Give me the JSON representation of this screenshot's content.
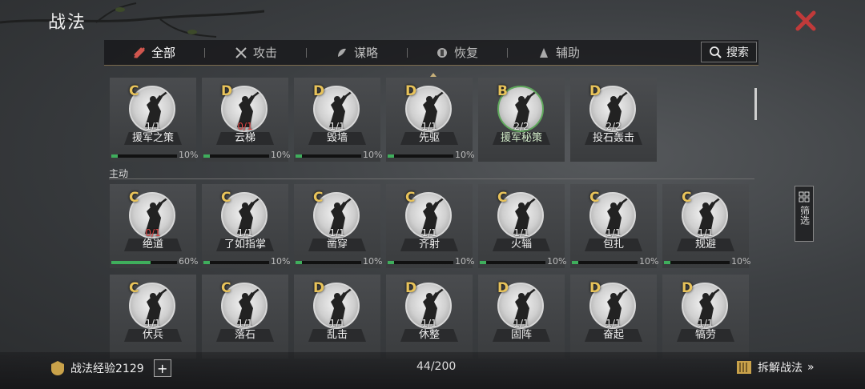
{
  "header": {
    "title": "战法"
  },
  "tabs": [
    {
      "label": "全部",
      "icon": "all-icon",
      "active": true
    },
    {
      "label": "攻击",
      "icon": "crossed-swords-icon",
      "active": false
    },
    {
      "label": "谋略",
      "icon": "strategy-icon",
      "active": false
    },
    {
      "label": "恢复",
      "icon": "recover-icon",
      "active": false
    },
    {
      "label": "辅助",
      "icon": "support-icon",
      "active": false
    }
  ],
  "search": {
    "label": "搜索"
  },
  "filter": {
    "label": "筛选"
  },
  "sections": {
    "active_label": "主动"
  },
  "cards": [
    {
      "grade": "C",
      "count": "1/1",
      "name": "援军之策",
      "progress": 10,
      "pct_text": "10%",
      "count_red": false,
      "green": false
    },
    {
      "grade": "D",
      "count": "0/1",
      "name": "云梯",
      "progress": 10,
      "pct_text": "10%",
      "count_red": true,
      "green": false
    },
    {
      "grade": "D",
      "count": "1/1",
      "name": "毁墙",
      "progress": 10,
      "pct_text": "10%",
      "count_red": false,
      "green": false
    },
    {
      "grade": "D",
      "count": "1/1",
      "name": "先驱",
      "progress": 10,
      "pct_text": "10%",
      "count_red": false,
      "green": false
    },
    {
      "grade": "B",
      "count": "2/2",
      "name": "援军秘策",
      "progress": null,
      "pct_text": "",
      "count_red": false,
      "green": true
    },
    {
      "grade": "D",
      "count": "2/2",
      "name": "投石轰击",
      "progress": null,
      "pct_text": "",
      "count_red": false,
      "green": false
    },
    {
      "grade": "C",
      "count": "0/1",
      "name": "绝道",
      "progress": 60,
      "pct_text": "60%",
      "count_red": true,
      "green": false
    },
    {
      "grade": "C",
      "count": "1/1",
      "name": "了如指掌",
      "progress": 10,
      "pct_text": "10%",
      "count_red": false,
      "green": false
    },
    {
      "grade": "C",
      "count": "1/1",
      "name": "凿穿",
      "progress": 10,
      "pct_text": "10%",
      "count_red": false,
      "green": false
    },
    {
      "grade": "C",
      "count": "1/1",
      "name": "齐射",
      "progress": 10,
      "pct_text": "10%",
      "count_red": false,
      "green": false
    },
    {
      "grade": "C",
      "count": "1/1",
      "name": "火辎",
      "progress": 10,
      "pct_text": "10%",
      "count_red": false,
      "green": false
    },
    {
      "grade": "C",
      "count": "1/1",
      "name": "包扎",
      "progress": 10,
      "pct_text": "10%",
      "count_red": false,
      "green": false
    },
    {
      "grade": "C",
      "count": "1/1",
      "name": "规避",
      "progress": 10,
      "pct_text": "10%",
      "count_red": false,
      "green": false
    },
    {
      "grade": "C",
      "count": "1/1",
      "name": "伏兵",
      "progress": null,
      "pct_text": "",
      "count_red": false,
      "green": false
    },
    {
      "grade": "C",
      "count": "1/1",
      "name": "落石",
      "progress": null,
      "pct_text": "",
      "count_red": false,
      "green": false
    },
    {
      "grade": "D",
      "count": "1/1",
      "name": "乱击",
      "progress": null,
      "pct_text": "",
      "count_red": false,
      "green": false
    },
    {
      "grade": "D",
      "count": "1/1",
      "name": "休整",
      "progress": null,
      "pct_text": "",
      "count_red": false,
      "green": false
    },
    {
      "grade": "D",
      "count": "1/1",
      "name": "固阵",
      "progress": null,
      "pct_text": "",
      "count_red": false,
      "green": false
    },
    {
      "grade": "D",
      "count": "1/1",
      "name": "奋起",
      "progress": null,
      "pct_text": "",
      "count_red": false,
      "green": false
    },
    {
      "grade": "D",
      "count": "1/1",
      "name": "犒劳",
      "progress": null,
      "pct_text": "",
      "count_red": false,
      "green": false
    }
  ],
  "footer": {
    "exp_label": "战法经验2129",
    "plus": "+",
    "page": "44/200",
    "decompose_label": "拆解战法",
    "decompose_arrow": "»"
  },
  "colors": {
    "grade": "#e8c35a",
    "progress": "#3fae5c",
    "close": "#c03a3a",
    "count_red": "#e04646"
  }
}
